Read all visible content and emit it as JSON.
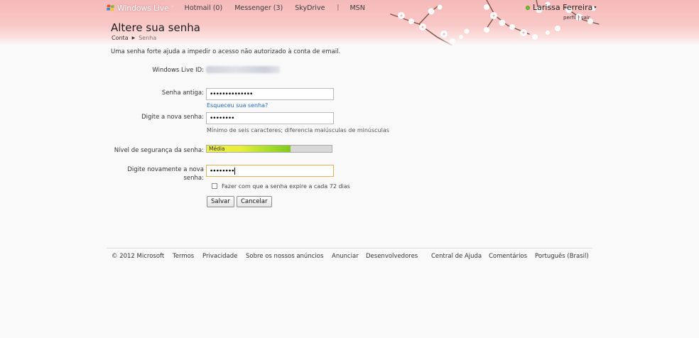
{
  "brand": {
    "name": "Windows Live",
    "tm": "™"
  },
  "nav": {
    "hotmail": "Hotmail (0)",
    "messenger": "Messenger (3)",
    "skydrive": "SkyDrive",
    "separator": "|",
    "msn": "MSN"
  },
  "user": {
    "name": "Larissa Ferreira",
    "caret": "▾",
    "profile": "perfil",
    "separator": "|",
    "signout": "sair"
  },
  "page": {
    "title": "Altere sua senha",
    "breadcrumb": {
      "root": "Conta",
      "arrow": "▶",
      "current": "Senha"
    },
    "intro": "Uma senha forte ajuda a impedir o acesso não autorizado à conta de email."
  },
  "form": {
    "id_label": "Windows Live ID:",
    "old_label": "Senha antiga:",
    "old_value": "••••••••••••••",
    "forgot_link": "Esqueceu sua senha?",
    "new_label": "Digite a nova senha:",
    "new_value": "••••••••",
    "new_hint": "Mínimo de seis caracteres; diferencia maiúsculas de minúsculas",
    "strength_label": "Nível de segurança da senha:",
    "strength_text": "Média",
    "strength_level": 0.67,
    "confirm_label_1": "Digite novamente a nova",
    "confirm_label_2": "senha:",
    "confirm_value": "••••••••",
    "expire_label": "Fazer com que a senha expire a cada 72 dias",
    "expire_checked": false,
    "save_button": "Salvar",
    "cancel_button": "Cancelar"
  },
  "footer": {
    "copyright": "© 2012 Microsoft",
    "terms": "Termos",
    "privacy": "Privacidade",
    "about_ads": "Sobre os nossos anúncios",
    "advertise": "Anunciar",
    "developers": "Desenvolvedores",
    "help": "Central de Ajuda",
    "feedback": "Comentários",
    "language": "Português (Brasil)"
  },
  "colors": {
    "header_pink": "#f5b9b9",
    "link_blue": "#1f6bc5",
    "focus_border": "#e6b04e",
    "presence_green": "#6fbf2f"
  }
}
